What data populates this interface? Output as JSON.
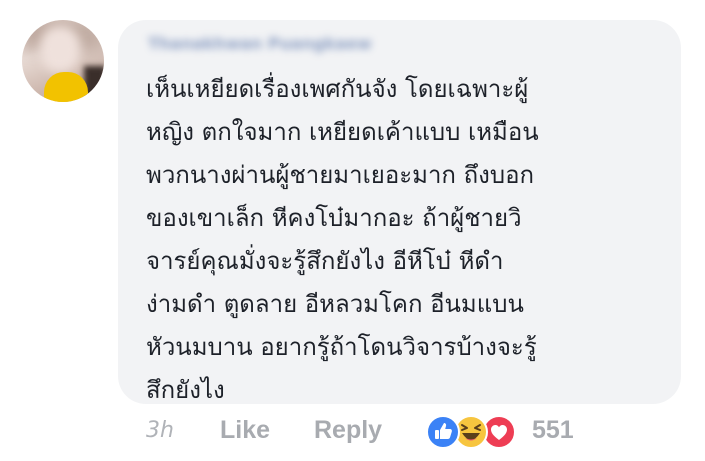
{
  "comment": {
    "author_name": "Thanakhwan Puangkaew",
    "lines": [
      "เห็นเหยียดเรื่องเพศกันจัง โดยเฉพาะผู้",
      "หญิง ตกใจมาก เหยียดเค้าแบบ เหมือน",
      "พวกนางผ่านผู้ชายมาเยอะมาก ถึงบอก",
      "ของเขาเล็ก หีคงโบ๋มากอะ ถ้าผู้ชายวิ",
      "จารย์คุณมั่งจะรู้สึกยังไง อีหีโบ๋ หีดำ",
      "ง่ามดำ ตูดลาย อีหลวมโคก อีนมแบน",
      "หัวนมบาน อยากรู้ถ้าโดนวิจารบ้างจะรู้",
      "สึกยังไง"
    ]
  },
  "actions": {
    "timestamp": "3h",
    "like_label": "Like",
    "reply_label": "Reply",
    "reaction_count": "551",
    "reaction_icons": [
      "like-icon",
      "haha-icon",
      "love-icon"
    ]
  },
  "colors": {
    "bubble_bg": "#f2f3f5",
    "text": "#1d2129",
    "muted": "#a8abb0",
    "like_blue": "#3b82f6",
    "haha_yellow": "#f7c53f",
    "love_red": "#ee3d54"
  }
}
